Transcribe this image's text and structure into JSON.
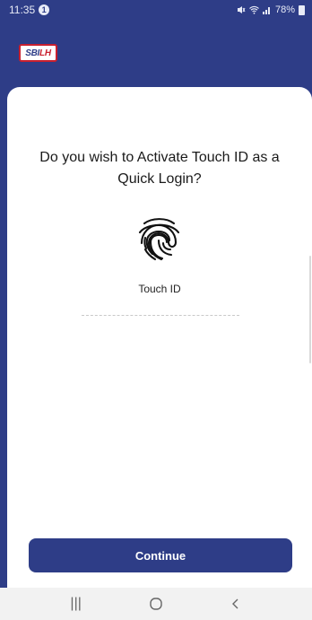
{
  "status_bar": {
    "time": "11:35",
    "notification_badge": "1",
    "battery": "78%"
  },
  "header": {
    "logo_sbi": "SBI",
    "logo_lh": "LH"
  },
  "prompt": {
    "title": "Do you wish to Activate Touch ID as a Quick Login?",
    "icon": "fingerprint-icon",
    "label": "Touch ID"
  },
  "actions": {
    "continue_label": "Continue"
  },
  "nav": {
    "recents": "|||",
    "home": "○",
    "back": "‹"
  },
  "colors": {
    "brand": "#2e3d87",
    "accent_red": "#c8202f"
  }
}
